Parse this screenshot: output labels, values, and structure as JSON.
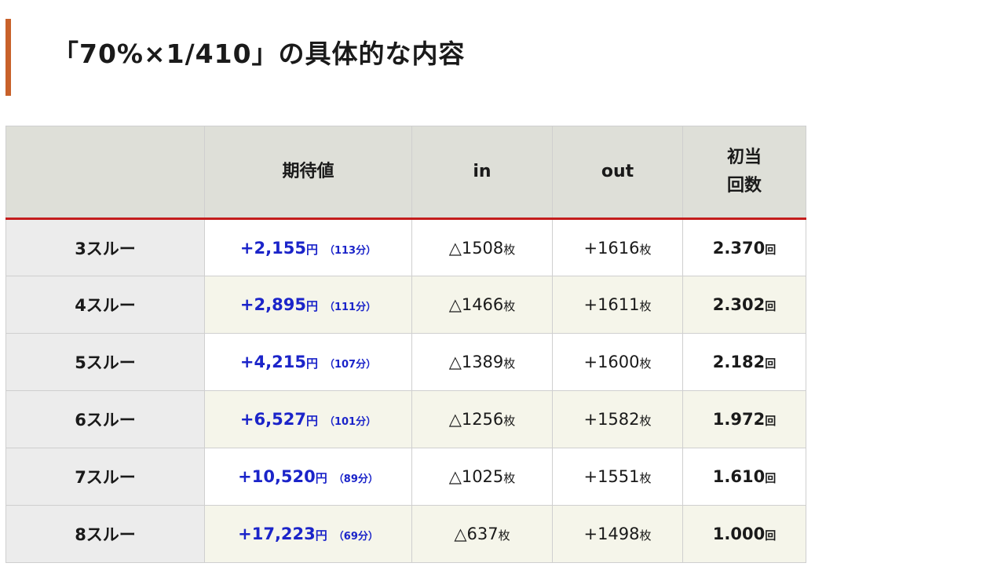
{
  "heading": {
    "title": "「70%×1/410」の具体的な内容"
  },
  "table": {
    "headers": {
      "label": "",
      "ev": "期待値",
      "in": "in",
      "out": "out",
      "hits_line1": "初当",
      "hits_line2": "回数"
    },
    "rows": [
      {
        "label": "3スルー",
        "ev": "+2,155",
        "ev_unit": "円",
        "mins": "（113分）",
        "in": "△1508",
        "in_unit": "枚",
        "out": "+1616",
        "out_unit": "枚",
        "hits": "2.370",
        "hits_unit": "回"
      },
      {
        "label": "4スルー",
        "ev": "+2,895",
        "ev_unit": "円",
        "mins": "（111分）",
        "in": "△1466",
        "in_unit": "枚",
        "out": "+1611",
        "out_unit": "枚",
        "hits": "2.302",
        "hits_unit": "回"
      },
      {
        "label": "5スルー",
        "ev": "+4,215",
        "ev_unit": "円",
        "mins": "（107分）",
        "in": "△1389",
        "in_unit": "枚",
        "out": "+1600",
        "out_unit": "枚",
        "hits": "2.182",
        "hits_unit": "回"
      },
      {
        "label": "6スルー",
        "ev": "+6,527",
        "ev_unit": "円",
        "mins": "（101分）",
        "in": "△1256",
        "in_unit": "枚",
        "out": "+1582",
        "out_unit": "枚",
        "hits": "1.972",
        "hits_unit": "回"
      },
      {
        "label": "7スルー",
        "ev": "+10,520",
        "ev_unit": "円",
        "mins": "（89分）",
        "in": "△1025",
        "in_unit": "枚",
        "out": "+1551",
        "out_unit": "枚",
        "hits": "1.610",
        "hits_unit": "回"
      },
      {
        "label": "8スルー",
        "ev": "+17,223",
        "ev_unit": "円",
        "mins": "（69分）",
        "in": "△637",
        "in_unit": "枚",
        "out": "+1498",
        "out_unit": "枚",
        "hits": "1.000",
        "hits_unit": "回"
      }
    ]
  },
  "colors": {
    "accent_bar": "#c8612a",
    "header_rule": "#c41d1d",
    "ev_text": "#1b24c9",
    "header_bg": "#dedfd8",
    "alt_row_bg": "#f5f5ea"
  }
}
